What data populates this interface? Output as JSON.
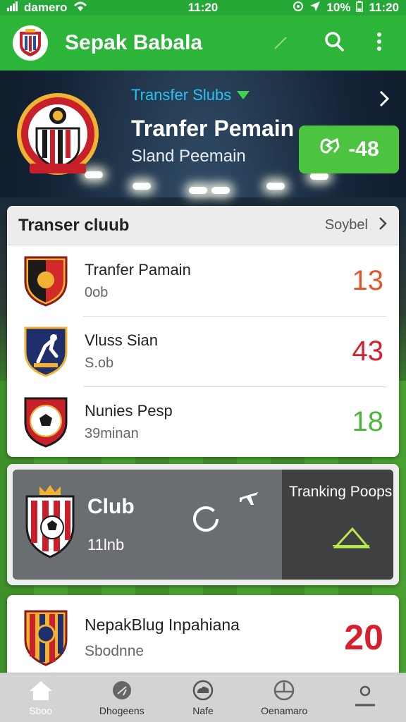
{
  "status_bar": {
    "carrier": "damero",
    "time_center": "11:20",
    "battery": "10%",
    "time_right": "11:20"
  },
  "app_bar": {
    "title": "Sepak Babala",
    "icons": [
      "app-logo-icon",
      "slash-icon",
      "search-icon",
      "more-vertical-icon"
    ]
  },
  "hero": {
    "subtitle": "Transfer Slubs",
    "title": "Tranfer Pemain",
    "caption": "Sland Peemain",
    "score": "-48"
  },
  "transfer_card": {
    "title": "Transer cluub",
    "link": "Soybel",
    "rows": [
      {
        "title": "Tranfer Pamain",
        "sub": "0ob",
        "value": "13",
        "value_color": "#e2562a"
      },
      {
        "title": "Vluss Sian",
        "sub": "S.ob",
        "value": "43",
        "value_color": "#d6202e"
      },
      {
        "title": "Nunies Pesp",
        "sub": "39minan",
        "value": "18",
        "value_color": "#4cb53a"
      }
    ]
  },
  "club_card": {
    "name": "Club",
    "sub": "11lnb",
    "tracking_title": "Tranking Poops"
  },
  "bottom_card": {
    "title": "NepakBlug Inpahiana",
    "sub": "Sbodnne",
    "value": "20",
    "value_color": "#d6202e"
  },
  "bottom_nav": [
    {
      "label": "Sboo",
      "icon": "home-icon"
    },
    {
      "label": "Dhogeens",
      "icon": "ball-icon"
    },
    {
      "label": "Nafe",
      "icon": "cloud-icon"
    },
    {
      "label": "Oenamaro",
      "icon": "compass-icon"
    },
    {
      "label": "",
      "icon": "profile-icon"
    }
  ],
  "colors": {
    "accent_green": "#2db53a",
    "status_green": "#25a836",
    "score_green": "#4cc43f",
    "link_blue": "#27c4f0"
  }
}
